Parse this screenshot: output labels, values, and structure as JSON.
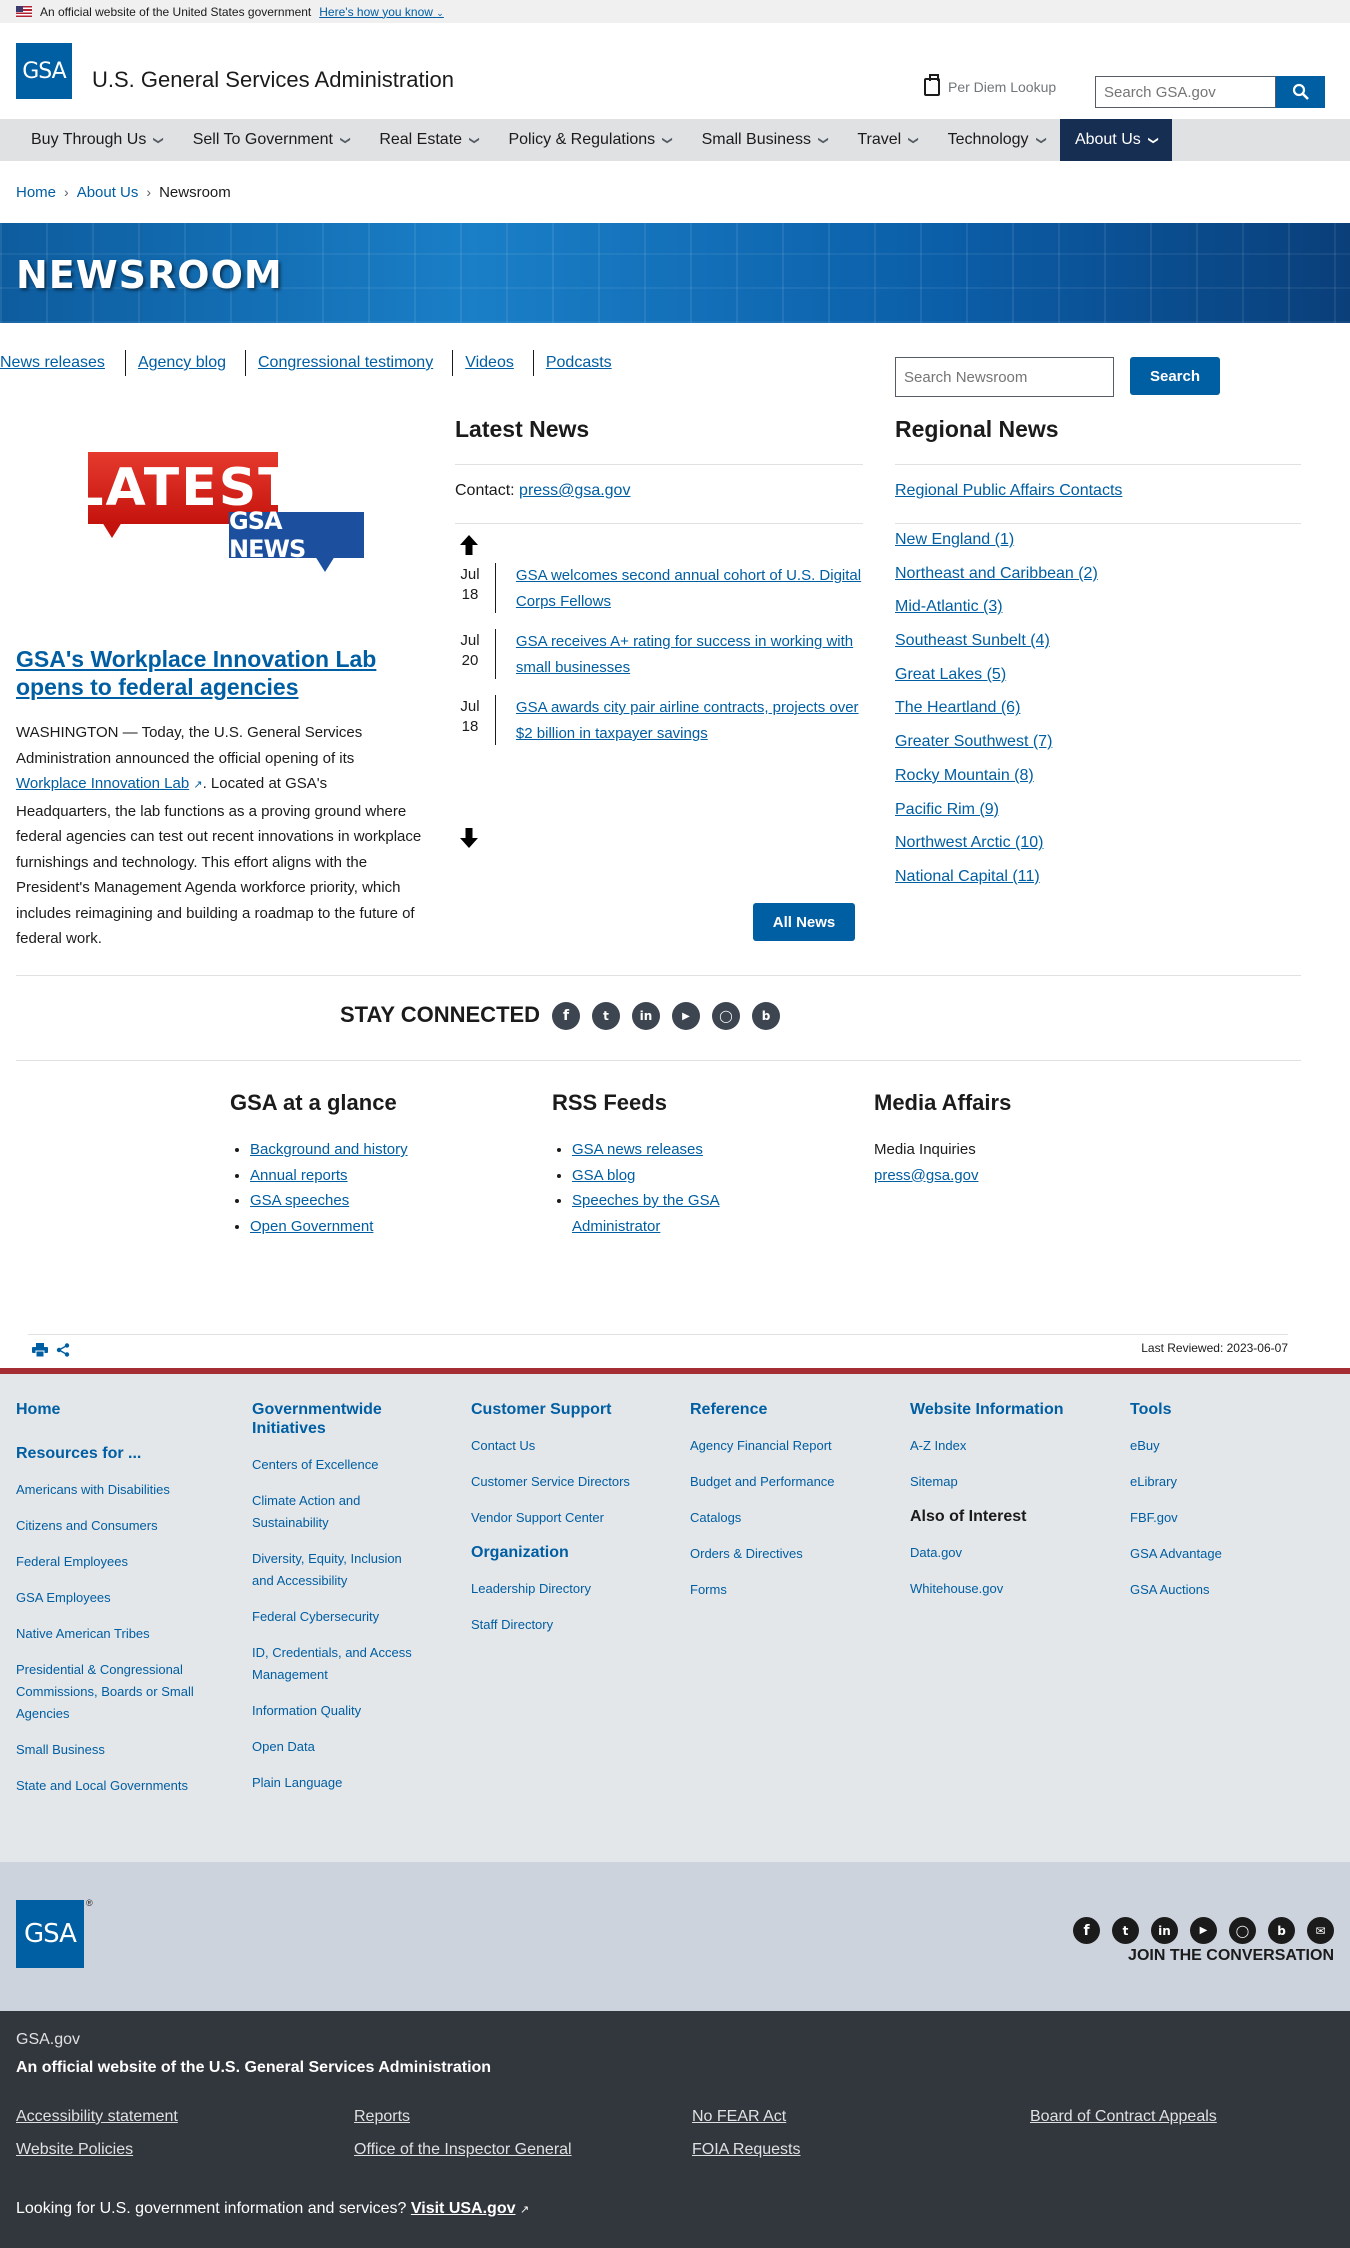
{
  "banner": {
    "text": "An official website of the United States government",
    "link": "Here's how you know"
  },
  "header": {
    "logo": "GSA",
    "site_name": "U.S. General Services Administration",
    "per_diem": "Per Diem Lookup",
    "search_placeholder": "Search GSA.gov"
  },
  "nav": [
    {
      "label": "Buy Through Us"
    },
    {
      "label": "Sell To Government"
    },
    {
      "label": "Real Estate"
    },
    {
      "label": "Policy & Regulations"
    },
    {
      "label": "Small Business"
    },
    {
      "label": "Travel"
    },
    {
      "label": "Technology"
    },
    {
      "label": "About Us"
    }
  ],
  "breadcrumb": [
    "Home",
    "About Us",
    "Newsroom"
  ],
  "hero": {
    "title": "NEWSROOM"
  },
  "sublinks": [
    "News releases",
    "Agency blog",
    "Congressional testimony",
    "Videos",
    "Podcasts"
  ],
  "newsroom_search": {
    "placeholder": "Search Newsroom",
    "button": "Search"
  },
  "feature": {
    "badge_top": "LATEST",
    "badge_bottom": "GSA NEWS",
    "title": "GSA's Workplace Innovation Lab opens to federal agencies",
    "body_1": "WASHINGTON — Today, the U.S. General Services Administration announced the official opening of its ",
    "body_link": "Workplace Innovation Lab",
    "body_2": ". Located at GSA's Headquarters, the lab functions as a proving ground where federal agencies can test out recent innovations in workplace furnishings and technology. This effort aligns with the President's Management Agenda workforce priority, which includes reimagining and building a roadmap to the future of federal work."
  },
  "latest": {
    "heading": "Latest News",
    "contact_label": "Contact:",
    "contact_email": "press@gsa.gov",
    "items": [
      {
        "month": "Jul",
        "day": "18",
        "title": "GSA welcomes second annual cohort of U.S. Digital Corps Fellows"
      },
      {
        "month": "Jul",
        "day": "20",
        "title": "GSA receives A+ rating for success in working with small businesses"
      },
      {
        "month": "Jul",
        "day": "18",
        "title": "GSA awards city pair airline contracts, projects over $2 billion in taxpayer savings"
      }
    ],
    "all_news": "All News"
  },
  "regional": {
    "heading": "Regional News",
    "contacts": "Regional Public Affairs Contacts",
    "regions": [
      "New England (1)",
      "Northeast and Caribbean (2)",
      "Mid-Atlantic (3)",
      "Southeast Sunbelt (4)",
      "Great Lakes (5)",
      "The Heartland (6)",
      "Greater Southwest (7)",
      "Rocky Mountain (8)",
      "Pacific Rim (9)",
      "Northwest Arctic (10)",
      "National Capital (11)"
    ]
  },
  "stay_connected": {
    "label": "STAY CONNECTED",
    "icons": [
      "facebook-icon",
      "twitter-icon",
      "linkedin-icon",
      "youtube-icon",
      "instagram-icon",
      "blog-icon"
    ]
  },
  "glance": {
    "heading": "GSA at a glance",
    "items": [
      "Background and history",
      "Annual reports",
      "GSA speeches",
      "Open Government"
    ]
  },
  "rss": {
    "heading": "RSS Feeds",
    "items": [
      "GSA news releases",
      "GSA blog",
      "Speeches by the GSA Administrator"
    ]
  },
  "media": {
    "heading": "Media Affairs",
    "label": "Media Inquiries",
    "email": "press@gsa.gov"
  },
  "last_reviewed": "Last Reviewed: 2023-06-07",
  "footer": {
    "home": "Home",
    "resources_heading": "Resources for ...",
    "resources": [
      "Americans with Disabilities",
      "Citizens and Consumers",
      "Federal Employees",
      "GSA Employees",
      "Native American Tribes",
      "Presidential & Congressional Commissions, Boards or Small Agencies",
      "Small Business",
      "State and Local Governments"
    ],
    "govwide_heading": "Governmentwide Initiatives",
    "govwide": [
      "Centers of Excellence",
      "Climate Action and Sustainability",
      "Diversity, Equity, Inclusion and Accessibility",
      "Federal Cybersecurity",
      "ID, Credentials, and Access Management",
      "Information Quality",
      "Open Data",
      "Plain Language"
    ],
    "support_heading": "Customer Support",
    "support": [
      "Contact Us",
      "Customer Service Directors",
      "Vendor Support Center"
    ],
    "org_heading": "Organization",
    "org": [
      "Leadership Directory",
      "Staff Directory"
    ],
    "reference_heading": "Reference",
    "reference": [
      "Agency Financial Report",
      "Budget and Performance",
      "Catalogs",
      "Orders & Directives",
      "Forms"
    ],
    "webinfo_heading": "Website Information",
    "webinfo": [
      "A-Z Index",
      "Sitemap"
    ],
    "interest_heading": "Also of Interest",
    "interest": [
      "Data.gov",
      "Whitehouse.gov"
    ],
    "tools_heading": "Tools",
    "tools": [
      "eBuy",
      "eLibrary",
      "FBF.gov",
      "GSA Advantage",
      "GSA Auctions"
    ],
    "join": "JOIN THE CONVERSATION",
    "site": "GSA.gov",
    "official": "An official website of the U.S. General Services Administration",
    "bottom_links": [
      "Accessibility statement",
      "Reports",
      "No FEAR Act",
      "Board of Contract Appeals",
      "Website Policies",
      "Office of the Inspector General",
      "FOIA Requests"
    ],
    "looking": "Looking for U.S. government information and services?",
    "visit": "Visit USA.gov"
  }
}
